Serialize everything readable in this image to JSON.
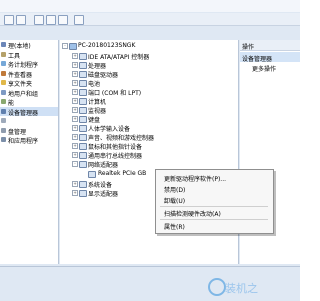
{
  "tree": {
    "root": "PC-20180123SNGK",
    "items": [
      "IDE ATA/ATAPI 控制器",
      "处理器",
      "磁盘驱动器",
      "电池",
      "端口 (COM 和 LPT)",
      "计算机",
      "监视器",
      "键盘",
      "人体学输入设备",
      "声音、视频和游戏控制器",
      "鼠标和其他指针设备",
      "通用串行总线控制器",
      "网络适配器",
      "Realtek PCIe GB",
      "系统设备",
      "显示适配器"
    ]
  },
  "left_pane": {
    "items": [
      {
        "label": "理(本地)"
      },
      {
        "label": "工具"
      },
      {
        "label": "务计划程序"
      },
      {
        "label": "件查看器"
      },
      {
        "label": "享文件夹"
      },
      {
        "label": "地用户和组"
      },
      {
        "label": "能"
      },
      {
        "label": "设备管理器",
        "selected": true
      },
      {
        "label": ""
      },
      {
        "label": "盘管理"
      },
      {
        "label": "和应用程序"
      }
    ]
  },
  "right_pane": {
    "header": "操作",
    "selected_item": "设备管理器",
    "more": "更多操作"
  },
  "context_menu": {
    "items": [
      "更新驱动程序软件(P)...",
      "禁用(D)",
      "卸载(U)",
      "扫描检测硬件改动(A)",
      "属性(R)"
    ]
  },
  "watermark": {
    "text": "装机之"
  }
}
